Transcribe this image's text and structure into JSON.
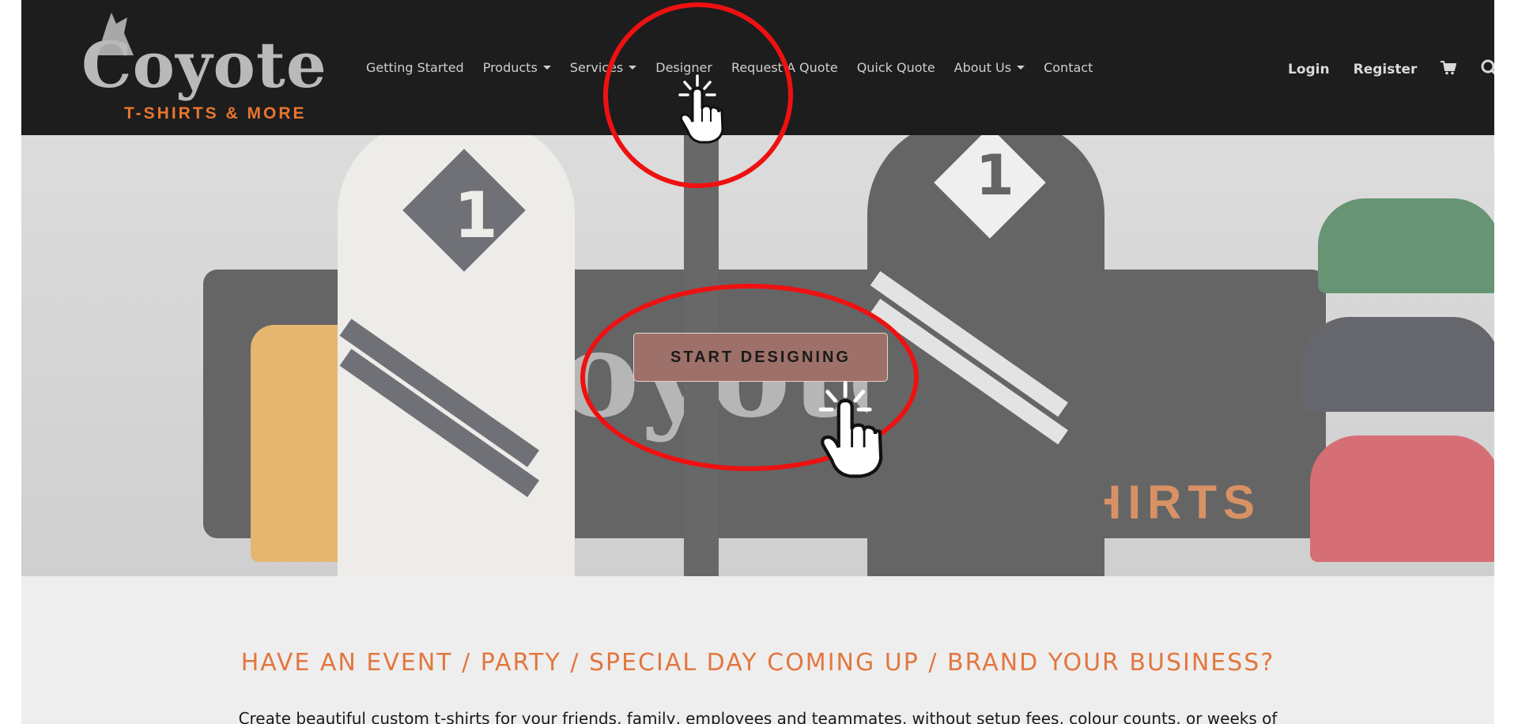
{
  "brand": {
    "logo_word": "Coyote",
    "logo_sub": "T-SHIRTS & MORE"
  },
  "nav": {
    "items": [
      {
        "label": "Getting Started",
        "has_dropdown": false
      },
      {
        "label": "Products",
        "has_dropdown": true
      },
      {
        "label": "Services",
        "has_dropdown": true
      },
      {
        "label": "Designer",
        "has_dropdown": false
      },
      {
        "label": "Request A Quote",
        "has_dropdown": false
      },
      {
        "label": "Quick Quote",
        "has_dropdown": false
      },
      {
        "label": "About Us",
        "has_dropdown": true
      },
      {
        "label": "Contact",
        "has_dropdown": false
      }
    ],
    "login_label": "Login",
    "register_label": "Register",
    "cart_icon": "shopping-cart-icon",
    "search_icon": "search-icon"
  },
  "hero": {
    "cta_label": "START DESIGNING",
    "sign_text": "Coyote",
    "sign_sub": "SHIRTS"
  },
  "section": {
    "headline": "HAVE AN EVENT / PARTY / SPECIAL DAY COMING UP / BRAND YOUR BUSINESS?",
    "paragraph": "Create beautiful custom t-shirts for your friends, family, employees and teammates, without setup fees, colour counts, or weeks of"
  },
  "colors": {
    "header_bg": "#1d1d1e",
    "accent_orange": "#e2773f",
    "cta_bg": "#9d7169",
    "annotation_red": "#ee1111"
  }
}
